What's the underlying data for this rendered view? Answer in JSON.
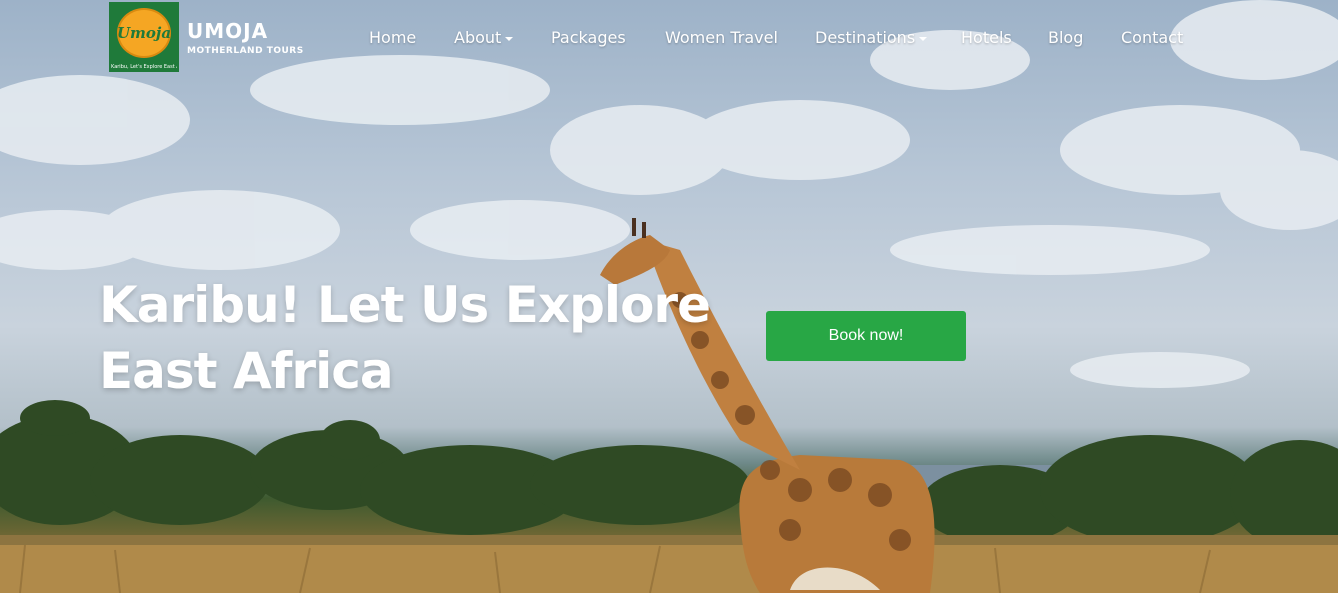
{
  "brand": {
    "name": "UMOJA",
    "subtitle": "MOTHERLAND TOURS",
    "logo_text": "Umoja",
    "logo_tagline": "Karibu, Let's Explore East Africa"
  },
  "nav": {
    "items": [
      {
        "label": "Home",
        "dropdown": false
      },
      {
        "label": "About",
        "dropdown": true
      },
      {
        "label": "Packages",
        "dropdown": false
      },
      {
        "label": "Women Travel",
        "dropdown": false
      },
      {
        "label": "Destinations",
        "dropdown": true
      },
      {
        "label": "Hotels",
        "dropdown": false
      },
      {
        "label": "Blog",
        "dropdown": false
      },
      {
        "label": "Contact",
        "dropdown": false
      }
    ]
  },
  "hero": {
    "headline_line1": "Karibu! Let Us Explore",
    "headline_line2": "East Africa",
    "cta_label": "Book now!"
  },
  "colors": {
    "cta": "#28a745",
    "logo_bg": "#1f7a3a",
    "logo_accent": "#f5a623"
  }
}
